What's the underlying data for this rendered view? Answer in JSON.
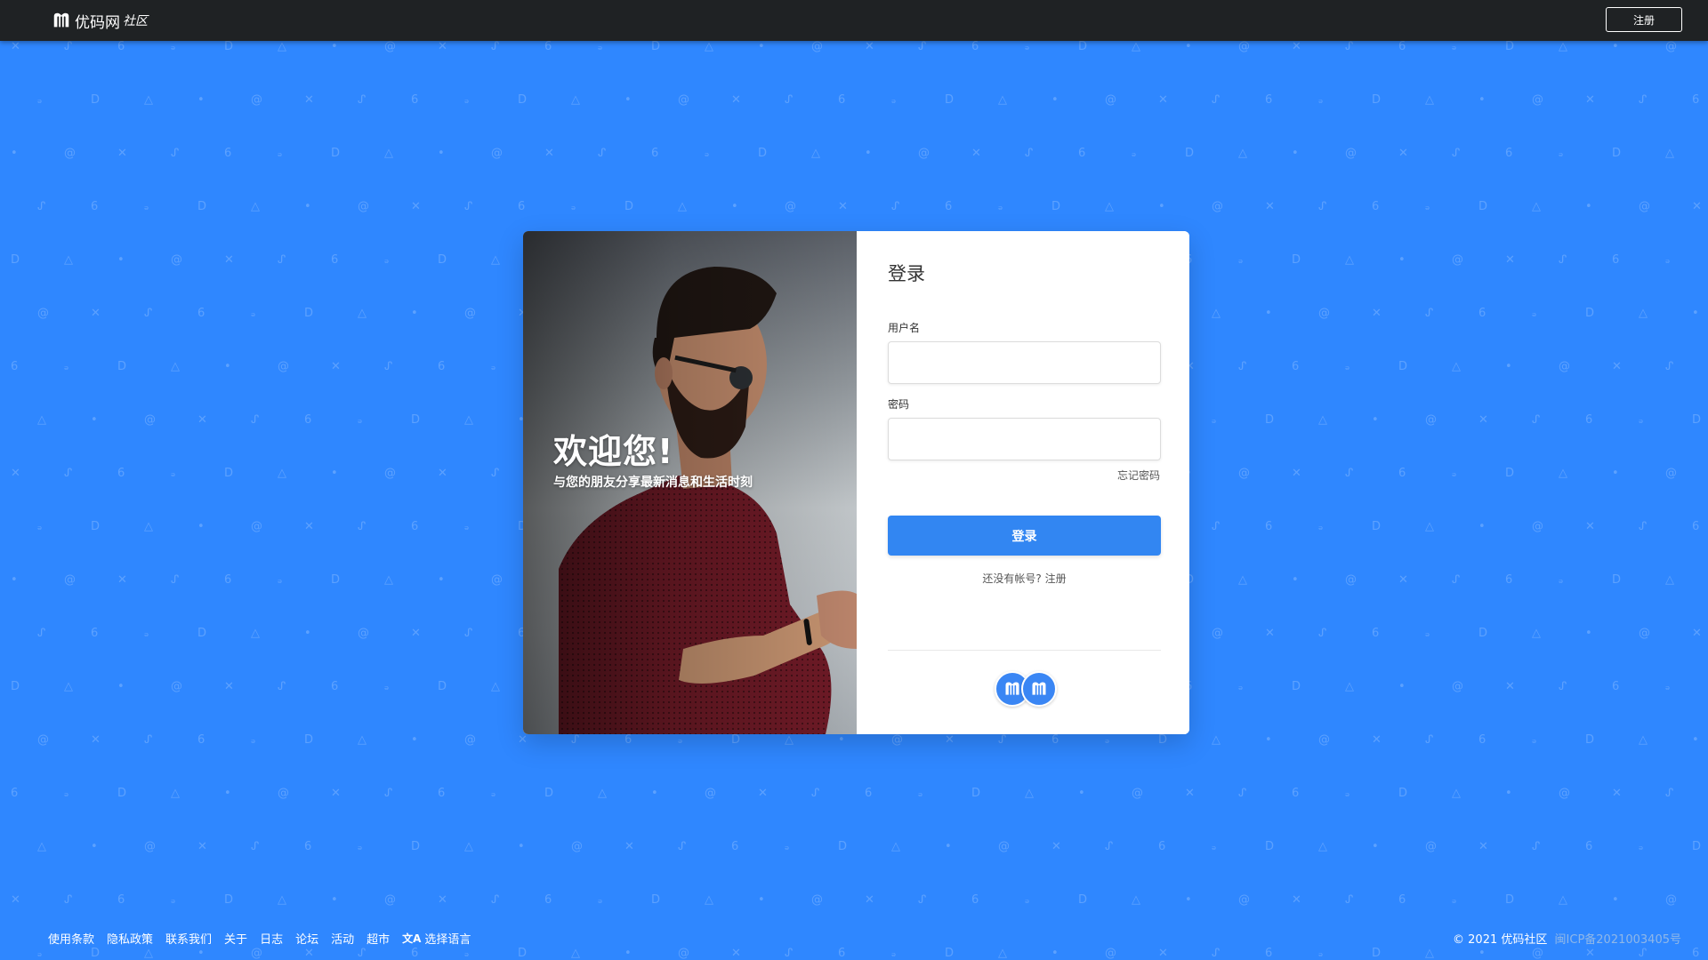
{
  "header": {
    "brand_name": "优码网",
    "brand_sub": "社区",
    "register_label": "注册"
  },
  "hero": {
    "title": "欢迎您!",
    "subtitle": "与您的朋友分享最新消息和生活时刻"
  },
  "login": {
    "title": "登录",
    "username_label": "用户名",
    "username_value": "",
    "password_label": "密码",
    "password_value": "",
    "forgot_label": "忘记密码",
    "submit_label": "登录",
    "no_account_text": "还没有帐号?",
    "register_link": "注册"
  },
  "footer": {
    "links": [
      "使用条款",
      "隐私政策",
      "联系我们",
      "关于",
      "日志",
      "论坛",
      "活动",
      "超市"
    ],
    "language_label": "选择语言",
    "copyright": "© 2021 优码社区",
    "icp": "闽ICP备2021003405号"
  },
  "colors": {
    "background": "#2f87ff",
    "topbar": "#1f2224",
    "button": "#3286f2"
  },
  "icons": [
    "brand-logo-icon",
    "translate-icon",
    "social-logo-icon"
  ]
}
